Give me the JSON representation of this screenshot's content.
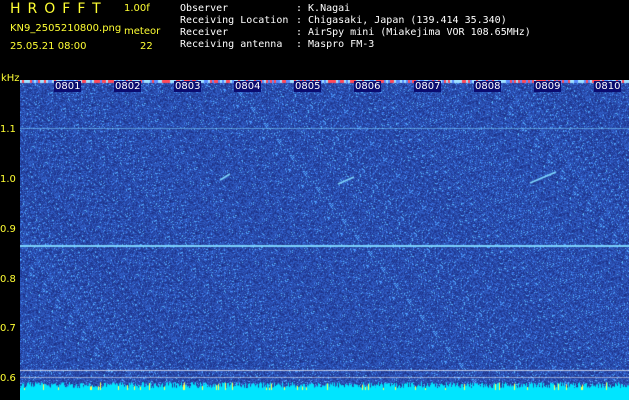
{
  "header": {
    "app_title": "HROFFT",
    "version": "1.00f",
    "filename": "KN9_2505210800.png",
    "datetime": "25.05.21 08:00",
    "meteor_label": "meteor",
    "meteor_count": "22"
  },
  "info": {
    "rows": [
      {
        "label": "Observer",
        "value": ": K.Nagai"
      },
      {
        "label": "Receiving Location",
        "value": ": Chigasaki, Japan (139.414 35.340)"
      },
      {
        "label": "Receiver",
        "value": ": AirSpy mini (Miakejima VOR 108.65MHz)"
      },
      {
        "label": "Receiving antenna",
        "value": ": Maspro FM-3"
      }
    ]
  },
  "spectrogram": {
    "y_unit": "kHz",
    "y_ticks": [
      "1.1",
      "1.0",
      "0.9",
      "0.8",
      "0.7",
      "0.6"
    ],
    "x_ticks": [
      "0801",
      "0802",
      "0803",
      "0804",
      "0805",
      "0806",
      "0807",
      "0808",
      "0809",
      "0810"
    ],
    "colors": {
      "background": "#0a0c70",
      "noise": "#3b6cff",
      "carrier": "#7fd7ff",
      "baseline": "#00e5ff",
      "tick_text": "#ffff33"
    }
  }
}
